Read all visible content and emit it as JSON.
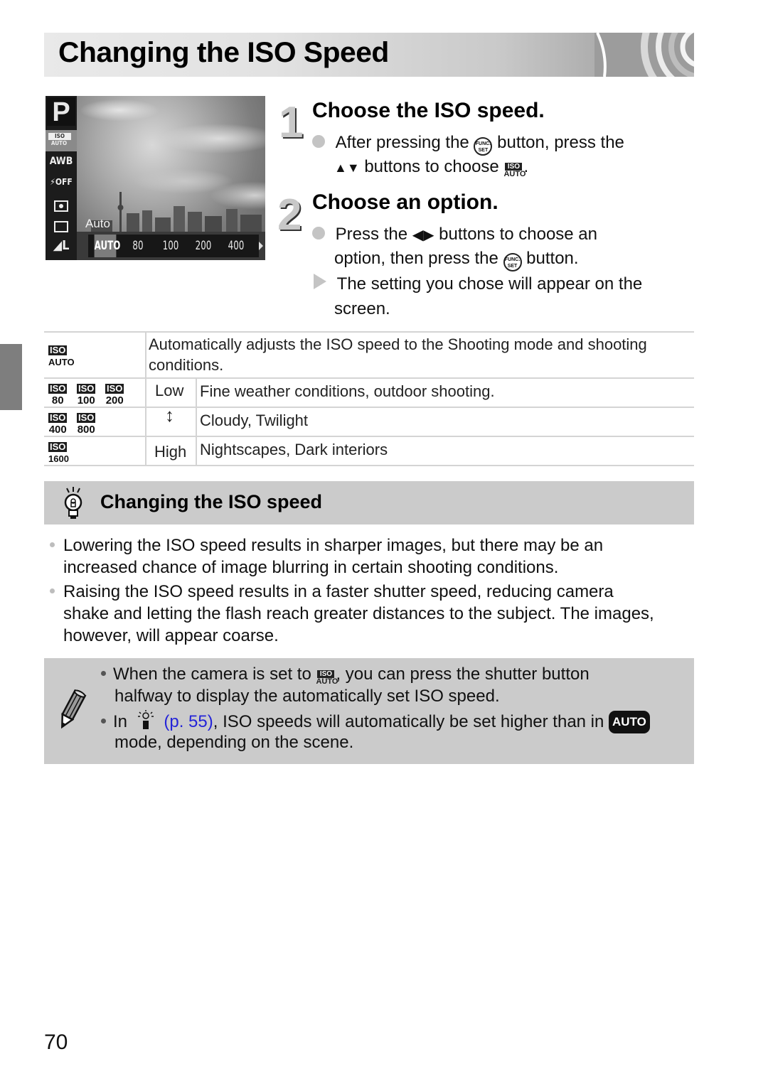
{
  "page": {
    "title": "Changing the ISO Speed",
    "page_number": "70"
  },
  "camera_screen": {
    "mode": "P",
    "side_menu": [
      "ISO AUTO",
      "AWB",
      "Flash OFF",
      "Metering",
      "Drive",
      "Image size L"
    ],
    "label": "Auto",
    "options": [
      "AUTO",
      "80",
      "100",
      "200",
      "400"
    ],
    "selected_option": "AUTO"
  },
  "steps": [
    {
      "number": "1",
      "title": "Choose the ISO speed.",
      "text_a": "After pressing the",
      "func_label_top": "FUNC.",
      "func_label_bottom": "SET",
      "text_b": "button, press the",
      "text_c": "buttons to choose",
      "text_d": ".",
      "updown_glyph": "▲▼"
    },
    {
      "number": "2",
      "title": "Choose an option.",
      "text_a": "Press the",
      "leftright_glyph": "◀▶",
      "text_b": "buttons to choose an",
      "text_c": "option, then press the",
      "text_d": "button.",
      "result_line1": "The setting you chose will appear on the",
      "result_line2": "screen."
    }
  ],
  "iso_table": {
    "rows": [
      {
        "icons": [
          "AUTO"
        ],
        "description_line1": "Automatically adjusts the ISO speed to the Shooting mode and shooting",
        "description_line2": "conditions."
      },
      {
        "icons": [
          "80",
          "100",
          "200"
        ],
        "description": "Fine weather conditions, outdoor shooting."
      },
      {
        "icons": [
          "400",
          "800"
        ],
        "description": "Cloudy, Twilight"
      },
      {
        "icons": [
          "1600"
        ],
        "description": "Nightscapes, Dark interiors"
      }
    ],
    "iso_badge": "ISO",
    "scale_low": "Low",
    "scale_arrow": "↕",
    "scale_high": "High"
  },
  "tip": {
    "title": "Changing the ISO speed",
    "bullets": [
      {
        "line1": "Lowering the ISO speed results in sharper images, but there may be an",
        "line2": "increased chance of image blurring in certain shooting conditions."
      },
      {
        "line1": "Raising the ISO speed results in a faster shutter speed, reducing camera",
        "line2": "shake and letting the flash reach greater distances to the subject. The images,",
        "line3": "however, will appear coarse."
      }
    ]
  },
  "note": {
    "b1_a": "When the camera is set to",
    "b1_b": ", you can press the shutter button",
    "b1_line2": "halfway to display the automatically set ISO speed.",
    "b2_a": "In",
    "b2_link": "(p. 55)",
    "b2_b": ", ISO speeds will automatically be set higher than in",
    "b2_badge": "AUTO",
    "b2_line2": "mode, depending on the scene."
  }
}
